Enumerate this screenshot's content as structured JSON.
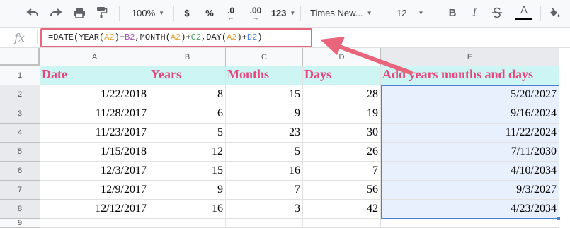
{
  "toolbar": {
    "zoom": "100%",
    "currency": "$",
    "percent": "%",
    "decrease_decimal": ".0",
    "increase_decimal": ".00",
    "number_format": "123",
    "font_family": "Times New...",
    "font_size": "12",
    "bold": "B",
    "italic": "I",
    "text_color_letter": "A",
    "colors": {
      "text_color_bar": "#000000",
      "accent_pink": "#e8457e"
    }
  },
  "formula_bar": {
    "fx_label": "fx",
    "formula_parts": [
      "=DATE(YEAR(",
      "A2",
      ")+",
      "B2",
      ",MONTH(",
      "A2",
      ")+",
      "C2",
      ",DAY(",
      "A2",
      ")+",
      "D2",
      ")"
    ]
  },
  "grid": {
    "columns": [
      "A",
      "B",
      "C",
      "D",
      "E"
    ],
    "rows": [
      "1",
      "2",
      "3",
      "4",
      "5",
      "6",
      "7",
      "8",
      "9"
    ],
    "header_row": [
      "Date",
      "Years",
      "Months",
      "Days",
      "Add years months and days"
    ],
    "data_rows": [
      [
        "1/22/2018",
        "8",
        "15",
        "28",
        "5/20/2027"
      ],
      [
        "11/28/2017",
        "6",
        "9",
        "19",
        "9/16/2024"
      ],
      [
        "11/23/2017",
        "5",
        "23",
        "30",
        "11/22/2024"
      ],
      [
        "1/15/2018",
        "12",
        "5",
        "26",
        "7/11/2030"
      ],
      [
        "12/3/2017",
        "15",
        "16",
        "7",
        "4/10/2034"
      ],
      [
        "12/9/2017",
        "9",
        "7",
        "56",
        "9/3/2027"
      ],
      [
        "12/12/2017",
        "16",
        "3",
        "42",
        "4/23/2034"
      ]
    ],
    "header_colors": {
      "fill": "#ccf5f3",
      "text": "#e8457e"
    },
    "selection_color": "#4a80d8"
  },
  "annotation": {
    "arrow_color": "#e8657c"
  }
}
